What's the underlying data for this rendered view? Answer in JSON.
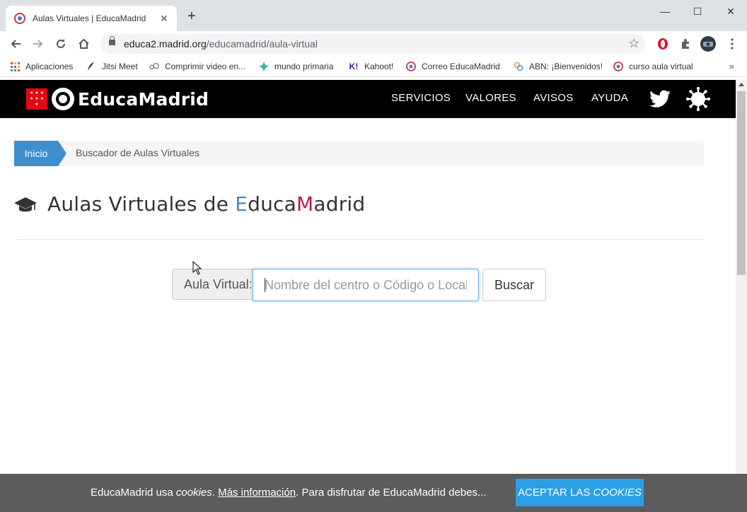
{
  "browser": {
    "tab": {
      "title": "Aulas Virtuales | EducaMadrid",
      "close": "✕"
    },
    "new_tab": "+",
    "window": {
      "minimize": "—",
      "maximize": "☐",
      "close": "✕"
    },
    "url": {
      "host": "educa2.madrid.org",
      "path": "/educamadrid/aula-virtual"
    },
    "bookmarks": [
      {
        "label": "Aplicaciones",
        "icon": "apps-grid-icon"
      },
      {
        "label": "Jitsi Meet",
        "icon": "feather-icon"
      },
      {
        "label": "Comprimir video en...",
        "icon": "compress-icon"
      },
      {
        "label": "mundo primaria",
        "icon": "star-burst-icon"
      },
      {
        "label": "Kahoot!",
        "icon": "kahoot-icon",
        "glyph": "K!"
      },
      {
        "label": "Correo EducaMadrid",
        "icon": "educamadrid-icon"
      },
      {
        "label": "ABN: ¡Bienvenidos!",
        "icon": "abn-icon"
      },
      {
        "label": "curso aula virtual",
        "icon": "educamadrid-icon"
      }
    ],
    "bookmarks_overflow": "»"
  },
  "site": {
    "logo_text": "EducaMadrid",
    "nav": [
      "SERVICIOS",
      "VALORES",
      "AVISOS",
      "AYUDA"
    ],
    "breadcrumb": {
      "home": "Inicio",
      "current": "Buscador de Aulas Virtuales"
    },
    "title": {
      "part1": "Aulas Virtuales de ",
      "e": "E",
      "part2": "duca",
      "m": "M",
      "part3": "adrid"
    },
    "search": {
      "label": "Aula Virtual:",
      "placeholder": "Nombre del centro o Código o Localidad",
      "button": "Buscar"
    }
  },
  "cookie": {
    "text_before": "EducaMadrid usa ",
    "cookies_word": "cookies",
    "text_dot": ". ",
    "more_info": "Más información",
    "text_after": ". Para disfrutar de EducaMadrid debes...",
    "accept_prefix": "ACEPTAR LAS ",
    "accept_cookies": "COOKIES"
  },
  "colors": {
    "brand_red": "#e30613",
    "accent_blue": "#3f8fcf",
    "title_e": "#4a86c8",
    "title_m": "#c0174d",
    "cookie_button": "#2a9ee6"
  }
}
